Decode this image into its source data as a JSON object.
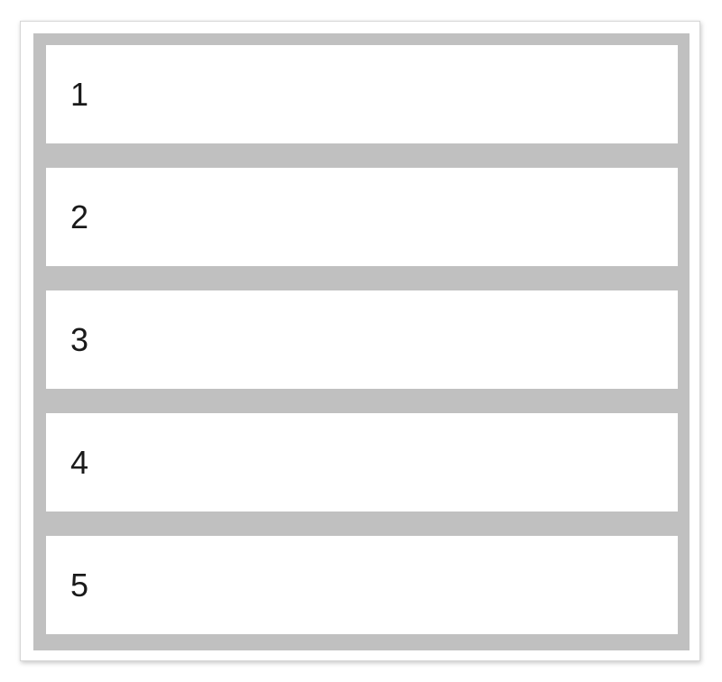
{
  "colors": {
    "page_background": "#ffffff",
    "container_background": "#c0c0c0",
    "item_background": "#ffffff",
    "text": "#1a1a1a"
  },
  "items": [
    {
      "label": "1"
    },
    {
      "label": "2"
    },
    {
      "label": "3"
    },
    {
      "label": "4"
    },
    {
      "label": "5"
    }
  ]
}
